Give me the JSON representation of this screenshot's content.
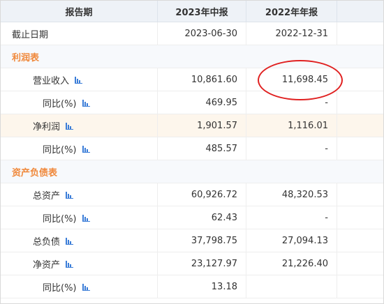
{
  "header": {
    "col_label": "报告期",
    "col_2023": "2023年中报",
    "col_2022": "2022年年报"
  },
  "date_row": {
    "label": "截止日期",
    "v2023": "2023-06-30",
    "v2022": "2022-12-31"
  },
  "sections": {
    "income": "利润表",
    "balance": "资产负债表"
  },
  "rows": [
    {
      "label": "营业收入",
      "v2023": "10,861.60",
      "v2022": "11,698.45"
    },
    {
      "label": "同比(%)",
      "v2023": "469.95",
      "v2022": "-"
    },
    {
      "label": "净利润",
      "v2023": "1,901.57",
      "v2022": "1,116.01"
    },
    {
      "label": "同比(%)",
      "v2023": "485.57",
      "v2022": "-"
    },
    {
      "label": "总资产",
      "v2023": "60,926.72",
      "v2022": "48,320.53"
    },
    {
      "label": "同比(%)",
      "v2023": "62.43",
      "v2022": "-"
    },
    {
      "label": "总负债",
      "v2023": "37,798.75",
      "v2022": "27,094.13"
    },
    {
      "label": "净资产",
      "v2023": "23,127.97",
      "v2022": "21,226.40"
    },
    {
      "label": "同比(%)",
      "v2023": "13.18",
      "v2022": ""
    }
  ],
  "colors": {
    "section_title": "#f0883a",
    "highlight_row": "#fdf6ec",
    "chart_icon": "#3b7dd8",
    "annotation_circle": "#e02020"
  }
}
